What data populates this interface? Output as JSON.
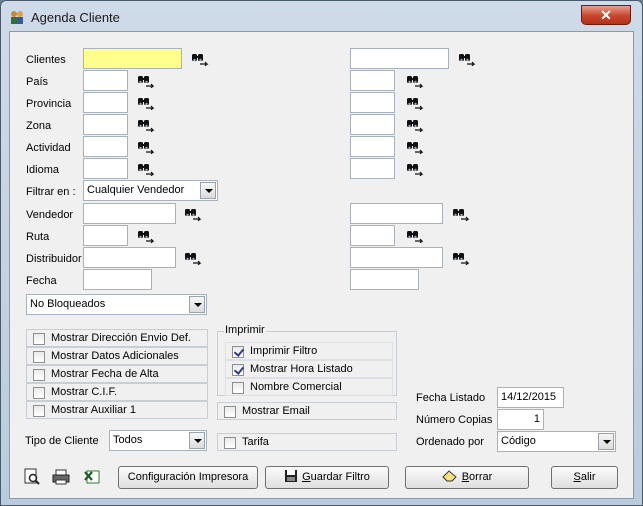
{
  "window": {
    "title": "Agenda Cliente",
    "close_glyph": "✕"
  },
  "fields": {
    "clientes": "Clientes",
    "pais": "País",
    "provincia": "Provincia",
    "zona": "Zona",
    "actividad": "Actividad",
    "idioma": "Idioma",
    "filtrar_en": "Filtrar en :",
    "filtrar_value": "Cualquier Vendedor",
    "vendedor": "Vendedor",
    "ruta": "Ruta",
    "distribuidor": "Distribuidor",
    "fecha": "Fecha",
    "bloqueo_value": "No Bloqueados"
  },
  "checks_left": [
    {
      "label": "Mostrar Dirección Envio Def.",
      "checked": false
    },
    {
      "label": "Mostrar Datos Adicionales",
      "checked": false
    },
    {
      "label": "Mostrar Fecha de Alta",
      "checked": false
    },
    {
      "label": "Mostrar C.I.F.",
      "checked": false
    },
    {
      "label": "Mostrar Auxiliar 1",
      "checked": false
    }
  ],
  "imprimir": {
    "title": "Imprimir",
    "items": [
      {
        "label": "Imprimir Filtro",
        "checked": true
      },
      {
        "label": "Mostrar Hora Listado",
        "checked": true
      },
      {
        "label": "Nombre Comercial",
        "checked": false
      }
    ]
  },
  "mostrar_email": "Mostrar Email",
  "tarifa": "Tarifa",
  "tipo_cliente": {
    "label": "Tipo de Cliente",
    "value": "Todos"
  },
  "fecha_listado": {
    "label": "Fecha Listado",
    "value": "14/12/2015"
  },
  "numero_copias": {
    "label": "Número Copias",
    "value": "1"
  },
  "ordenado_por": {
    "label": "Ordenado por",
    "value": "Código"
  },
  "buttons": {
    "config": "Configuración Impresora",
    "guardar_pre": "G",
    "guardar_post": "uardar Filtro",
    "borrar_pre": "B",
    "borrar_post": "orrar",
    "salir_pre": "S",
    "salir_post": "alir"
  },
  "colors": {
    "highlight_field": "#ffff8c",
    "close_button": "#c7452c"
  }
}
